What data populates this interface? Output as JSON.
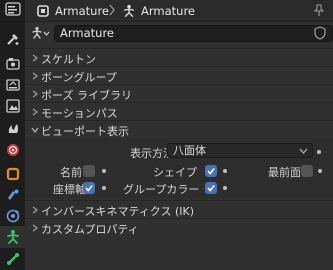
{
  "header": {
    "object_name": "Armature",
    "data_name": "Armature"
  },
  "name_row": {
    "value": "Armature"
  },
  "panels": [
    {
      "label": "スケルトン",
      "expanded": false
    },
    {
      "label": "ボーングループ",
      "expanded": false
    },
    {
      "label": "ポーズ ライブラリ",
      "expanded": false
    },
    {
      "label": "モーションパス",
      "expanded": false
    },
    {
      "label": "ビューポート表示",
      "expanded": true
    },
    {
      "label": "インバースキネマティクス (IK)",
      "expanded": false
    },
    {
      "label": "カスタムプロパティ",
      "expanded": false
    }
  ],
  "viewport_display": {
    "display_as_label": "表示方法",
    "display_as_value": "八面体",
    "names_label": "名前",
    "names_checked": false,
    "shapes_label": "シェイプ",
    "shapes_checked": true,
    "in_front_label": "最前面",
    "in_front_checked": false,
    "axes_label": "座標軸",
    "axes_checked": true,
    "group_colors_label": "グループカラー",
    "group_colors_checked": true
  },
  "tabs": [
    {
      "icon": "tool-icon"
    },
    {
      "icon": "render-icon"
    },
    {
      "icon": "output-icon"
    },
    {
      "icon": "view-layer-icon"
    },
    {
      "icon": "scene-icon"
    },
    {
      "icon": "world-icon"
    },
    {
      "icon": "object-icon"
    },
    {
      "icon": "modifier-icon"
    },
    {
      "icon": "physics-icon"
    },
    {
      "icon": "armature-data-icon",
      "active": true
    },
    {
      "icon": "bone-icon"
    }
  ],
  "colors": {
    "accent": "#4772b3",
    "panel_bg": "#303030",
    "tab_bg": "#1d1d1d",
    "armature_green": "#3dc36e"
  }
}
